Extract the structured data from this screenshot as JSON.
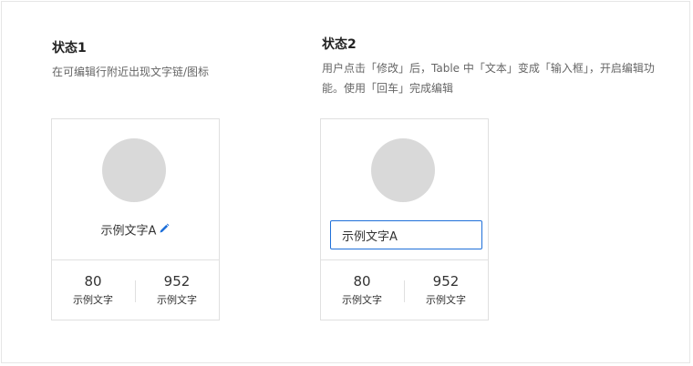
{
  "state1": {
    "title": "状态1",
    "description": "在可编辑行附近出现文字链/图标",
    "card": {
      "name": "示例文字A",
      "stats": [
        {
          "value": "80",
          "label": "示例文字"
        },
        {
          "value": "952",
          "label": "示例文字"
        }
      ]
    }
  },
  "state2": {
    "title": "状态2",
    "description": "用户点击「修改」后，Table 中「文本」变成「输入框」，开启编辑功能。使用「回车」完成编辑",
    "card": {
      "input_value": "示例文字A",
      "stats": [
        {
          "value": "80",
          "label": "示例文字"
        },
        {
          "value": "952",
          "label": "示例文字"
        }
      ]
    }
  },
  "colors": {
    "accent": "#1e6fd9",
    "avatar": "#d9d9d9",
    "border": "#e0e0e0"
  },
  "icons": {
    "edit": "pencil-icon"
  }
}
